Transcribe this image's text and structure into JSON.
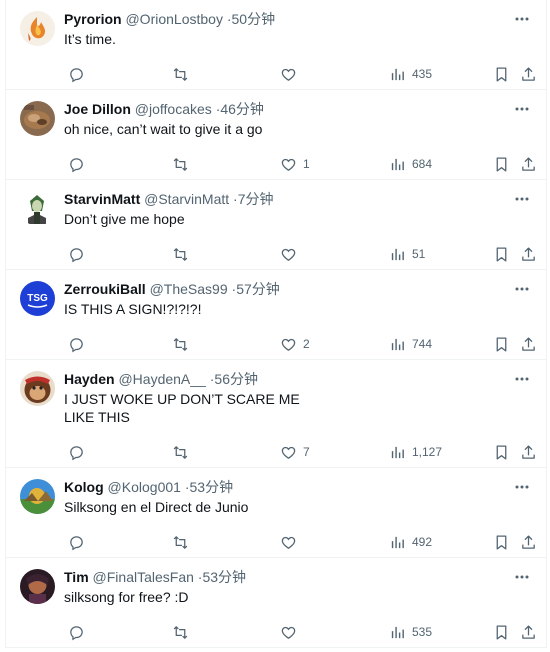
{
  "tweets": [
    {
      "name": "Pyrorion",
      "handle": "@OrionLostboy",
      "time": "50分钟",
      "text": "It’s time.",
      "likes": "",
      "views": "435",
      "avatar": "avatar-flame",
      "height": 90
    },
    {
      "name": "Joe Dillon",
      "handle": "@joffocakes",
      "time": "46分钟",
      "text": "oh nice, can’t wait to give it a go",
      "likes": "1",
      "views": "684",
      "avatar": "avatar-food",
      "height": 90
    },
    {
      "name": "StarvinMatt",
      "handle": "@StarvinMatt",
      "time": "7分钟",
      "text": "Don’t give me hope",
      "likes": "",
      "views": "51",
      "avatar": "avatar-cell",
      "height": 90
    },
    {
      "name": "ZerroukiBall",
      "handle": "@TheSas99",
      "time": "57分钟",
      "text": "IS THIS A SIGN!?!?!?!",
      "likes": "2",
      "views": "744",
      "avatar": "avatar-tsg",
      "height": 90
    },
    {
      "name": "Hayden",
      "handle": "@HaydenA__",
      "time": "56分钟",
      "text": "I JUST WOKE UP DON’T SCARE ME LIKE THIS",
      "likes": "7",
      "views": "1,127",
      "avatar": "avatar-kong",
      "height": 108
    },
    {
      "name": "Kolog",
      "handle": "@Kolog001",
      "time": "53分钟",
      "text": "Silksong en el Direct de Junio",
      "likes": "",
      "views": "492",
      "avatar": "avatar-landscape",
      "height": 90
    },
    {
      "name": "Tim",
      "handle": "@FinalTalesFan",
      "time": "53分钟",
      "text": "silksong for free? :D",
      "likes": "",
      "views": "535",
      "avatar": "avatar-portrait",
      "height": 90
    }
  ],
  "colors": {
    "text": "#0f1419",
    "muted": "#536471",
    "border": "#eff3f4",
    "tsg_blue": "#1d3fd6"
  }
}
